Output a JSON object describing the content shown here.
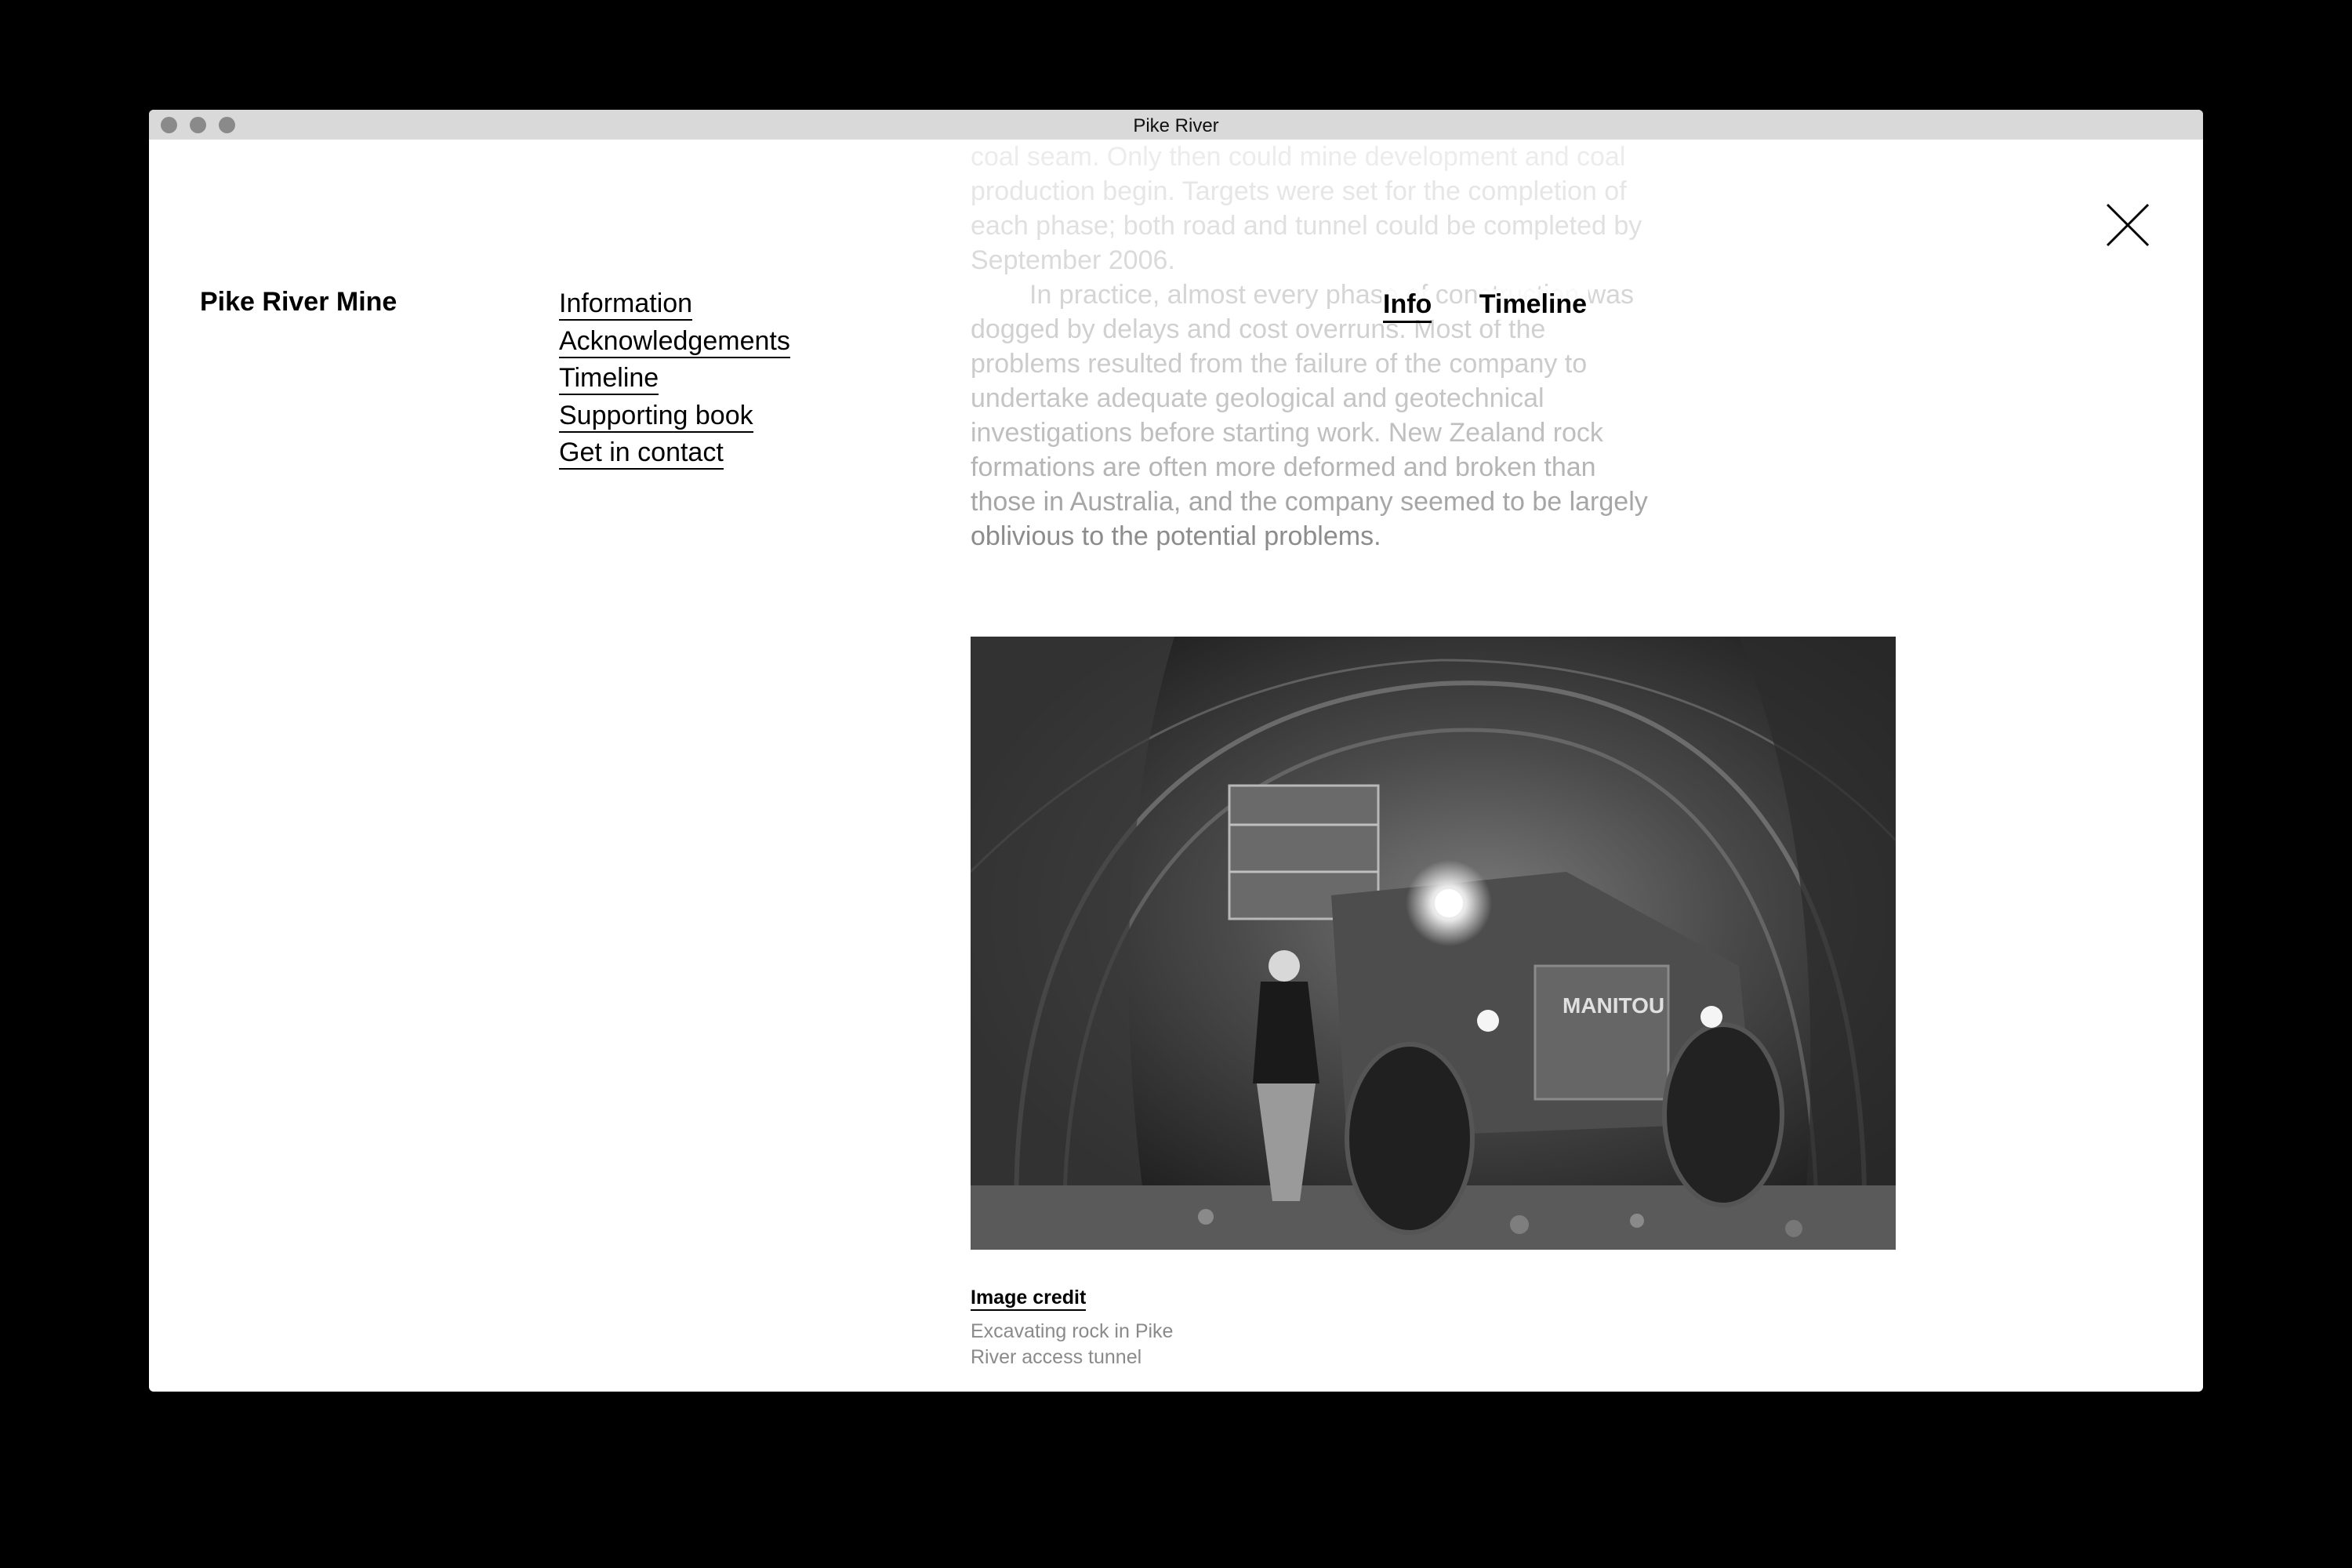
{
  "window": {
    "title": "Pike River"
  },
  "site": {
    "title": "Pike River Mine"
  },
  "side_nav": {
    "items": [
      {
        "label": "Information"
      },
      {
        "label": "Acknowledgements"
      },
      {
        "label": "Timeline"
      },
      {
        "label": "Supporting book"
      },
      {
        "label": "Get in contact"
      }
    ]
  },
  "top_tabs": {
    "items": [
      {
        "label": "Info",
        "active": true
      },
      {
        "label": "Timeline",
        "active": false
      }
    ]
  },
  "article": {
    "paragraph1_lines": [
      "coal seam. Only then could mine development and coal",
      "production begin. Targets were set for the completion of",
      "each phase; both road and tunnel could be completed by",
      "September 2006."
    ],
    "paragraph2_lines": [
      "In practice, almost every phase of construction was",
      "dogged by delays and cost overruns. Most of the",
      "problems resulted from the failure of the company to",
      "undertake adequate geological and geotechnical",
      "investigations before starting work. New Zealand rock",
      "formations are often more deformed and broken than",
      "those in Australia, and the company seemed to be largely",
      "oblivious to the potential problems."
    ]
  },
  "image": {
    "vehicle_brand_text": "MANITOU",
    "credit_label": "Image credit",
    "caption_lines": [
      "Excavating rock in Pike",
      "River access tunnel"
    ]
  },
  "icons": {
    "close": "close-icon"
  },
  "colors": {
    "background": "#000000",
    "window": "#ffffff",
    "titlebar": "#d9d9d9",
    "text": "#000000",
    "caption": "#8a8a8a"
  }
}
